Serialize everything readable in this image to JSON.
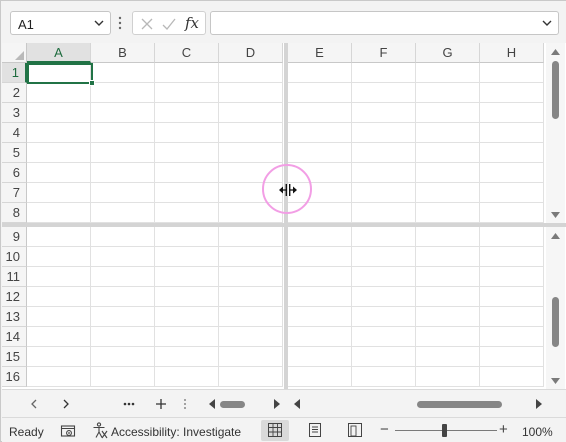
{
  "name_box": {
    "value": "A1"
  },
  "formula_bar": {
    "fx_label": "fx",
    "value": ""
  },
  "columns_left": [
    "A",
    "B",
    "C",
    "D"
  ],
  "columns_right": [
    "E",
    "F",
    "G",
    "H"
  ],
  "rows_top": [
    "1",
    "2",
    "3",
    "4",
    "5",
    "6",
    "7",
    "8"
  ],
  "rows_bottom": [
    "9",
    "10",
    "11",
    "12",
    "13",
    "14",
    "15",
    "16"
  ],
  "selected_cell": "A1",
  "status": {
    "ready": "Ready",
    "accessibility": "Accessibility: Investigate",
    "zoom": "100%",
    "zoom_level_pct": 100
  },
  "colors": {
    "accent": "#217346",
    "cursor_highlight": "#f29ee5"
  },
  "icons": [
    "chevron-down-icon",
    "more-vertical-icon",
    "cancel-icon",
    "enter-icon",
    "fx-icon",
    "select-all-icon",
    "scroll-up-icon",
    "scroll-down-icon",
    "chevron-left-icon",
    "chevron-right-icon",
    "more-horizontal-icon",
    "plus-icon",
    "macro-record-icon",
    "accessibility-icon",
    "normal-view-icon",
    "page-layout-icon",
    "page-break-icon",
    "split-resize-cursor-icon"
  ]
}
